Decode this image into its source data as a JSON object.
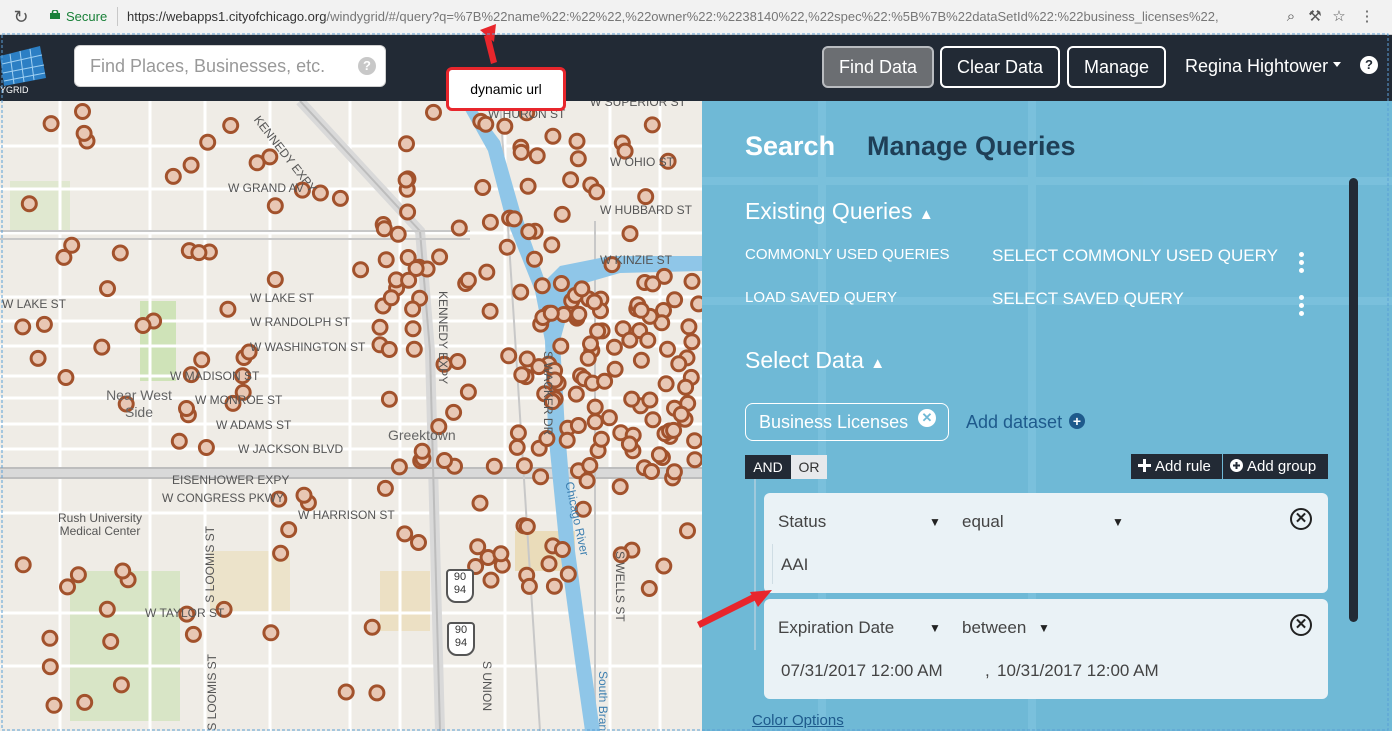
{
  "browser": {
    "secure_label": "Secure",
    "url_host": "https://webapps1.cityofchicago.org",
    "url_path": "/windygrid/#/query?q=%7B%22name%22:%22%22,%22owner%22:%2238140%22,%22spec%22:%5B%7B%22dataSetId%22:%22business_licenses%22,"
  },
  "header": {
    "search_placeholder": "Find Places, Businesses, etc.",
    "find_data": "Find Data",
    "clear_data": "Clear Data",
    "manage": "Manage",
    "user_name": "Regina Hightower",
    "help": "?"
  },
  "annotation": {
    "callout": "dynamic url"
  },
  "map": {
    "labels": {
      "kennedy_expy": "KENNEDY EXPY",
      "grand": "W GRAND AV",
      "lake": "W LAKE ST",
      "lake2": "W LAKE ST",
      "randolph": "W RANDOLPH ST",
      "washington": "W WASHINGTON ST",
      "madison": "W MADISON ST",
      "monroe": "W MONROE ST",
      "adams": "W ADAMS ST",
      "jackson": "W JACKSON BLVD",
      "near_west_side": "Near West Side",
      "eisenhower": "EISENHOWER EXPY",
      "congress": "W CONGRESS PKWY",
      "harrison": "W HARRISON ST",
      "taylor": "W TAYLOR ST",
      "rush": "Rush University Medical Center",
      "hubbard": "W HUBBARD ST",
      "kinzie": "W KINZIE ST",
      "ohio": "W OHIO ST",
      "superior": "W SUPERIOR ST",
      "huron": "W HURON ST",
      "chicago_river": "Chicago River",
      "kennedy_vertical": "KENNEDY EXPY",
      "greektown": "Greektown",
      "wacker": "S WACKER DR",
      "loomis": "S LOOMIS ST",
      "loomis2": "S LOOMIS ST",
      "union": "S UNION",
      "wells": "S WELLS ST",
      "south_branch": "South Branch",
      "shield_90_94_a": "90",
      "shield_94_a": "94",
      "shield_90_94_b": "90",
      "shield_94_b": "94"
    }
  },
  "panel": {
    "tab_search": "Search",
    "tab_manage": "Manage Queries",
    "existing_queries": "Existing Queries",
    "commonly_used_label": "COMMONLY USED QUERIES",
    "commonly_used_value": "SELECT COMMONLY USED QUERY",
    "saved_label": "LOAD SAVED QUERY",
    "saved_value": "SELECT SAVED QUERY",
    "select_data": "Select Data",
    "dataset": "Business Licenses",
    "add_dataset": "Add dataset",
    "and": "AND",
    "or": "OR",
    "add_rule": "Add rule",
    "add_group": "Add group",
    "rule1": {
      "field": "Status",
      "operator": "equal",
      "value": "AAI"
    },
    "rule2": {
      "field": "Expiration Date",
      "operator": "between",
      "value_from": "07/31/2017 12:00 AM",
      "separator": ",",
      "value_to": "10/31/2017 12:00 AM"
    },
    "color_options": "Color Options"
  }
}
